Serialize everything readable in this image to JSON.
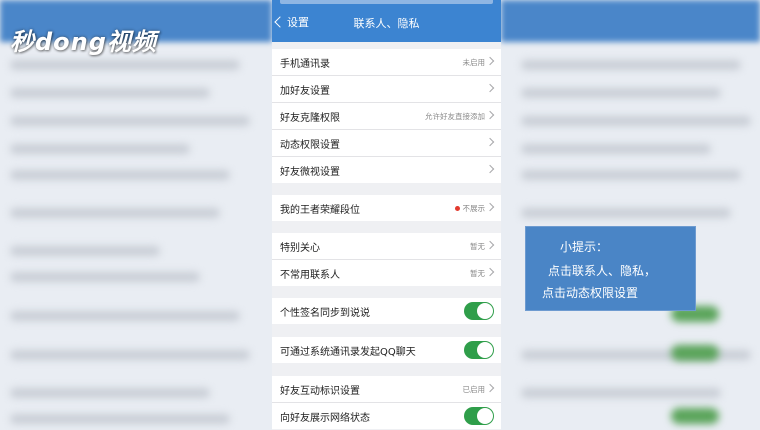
{
  "watermark": "秒dong视频",
  "nav": {
    "back_label": "设置",
    "title": "联系人、隐私"
  },
  "groups": [
    {
      "rows": [
        {
          "label": "手机通讯录",
          "value": "未启用"
        },
        {
          "label": "加好友设置",
          "value": ""
        },
        {
          "label": "好友克隆权限",
          "value": "允许好友直接添加"
        },
        {
          "label": "动态权限设置",
          "value": ""
        },
        {
          "label": "好友微视设置",
          "value": ""
        }
      ]
    },
    {
      "rows": [
        {
          "label": "我的王者荣耀段位",
          "value": "不展示"
        }
      ]
    },
    {
      "rows": [
        {
          "label": "特别关心",
          "value": "暂无"
        },
        {
          "label": "不常用联系人",
          "value": "暂无"
        }
      ]
    },
    {
      "rows": [
        {
          "label": "个性签名同步到说说",
          "toggle": true
        }
      ]
    },
    {
      "rows": [
        {
          "label": "可通过系统通讯录发起QQ聊天",
          "toggle": true
        }
      ]
    },
    {
      "rows": [
        {
          "label": "好友互动标识设置",
          "value": "已启用"
        },
        {
          "label": "向好友展示网络状态",
          "toggle": true
        }
      ]
    }
  ],
  "tip": {
    "title": "小提示：",
    "line1": "点击联系人、隐私，",
    "line2": "点击动态权限设置"
  },
  "colors": {
    "nav": "#3c84d1",
    "toggle_on": "#2f9e4a",
    "tip_bg": "#4a85c6"
  }
}
